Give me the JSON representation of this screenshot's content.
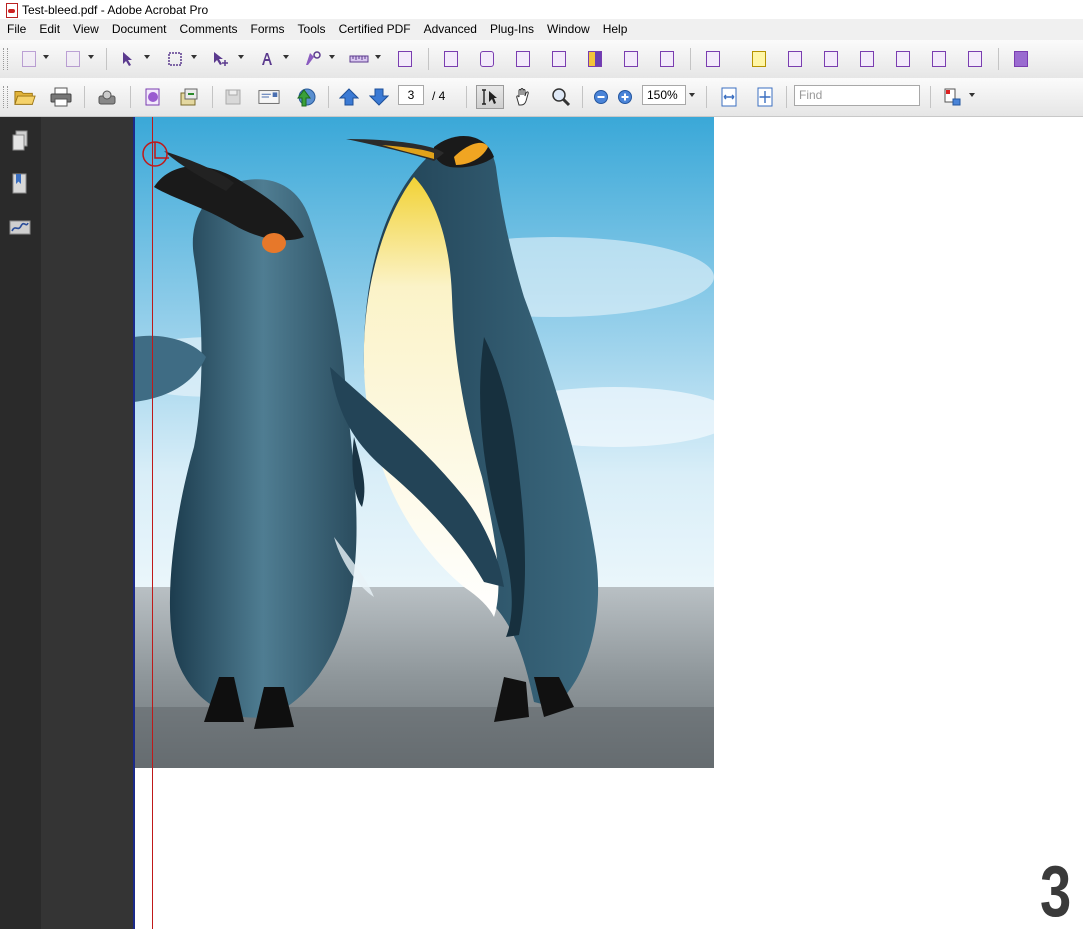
{
  "window": {
    "title": "Test-bleed.pdf - Adobe Acrobat Pro",
    "app_icon": "pdf-file-icon"
  },
  "menu": [
    "File",
    "Edit",
    "View",
    "Document",
    "Comments",
    "Forms",
    "Tools",
    "Certified PDF",
    "Advanced",
    "Plug-Ins",
    "Window",
    "Help"
  ],
  "navigation": {
    "current_page": "3",
    "total_pages": "/ 4"
  },
  "zoom": {
    "level": "150%"
  },
  "find": {
    "placeholder": "Find"
  },
  "document": {
    "page_number_label": "3"
  },
  "colors": {
    "bleed_line": "#c01919",
    "page_edge": "#1b2a8a",
    "toolbar_accent": "#7a3db0",
    "sidebar_bg": "#2a2a2a",
    "viewer_bg": "#343434"
  }
}
